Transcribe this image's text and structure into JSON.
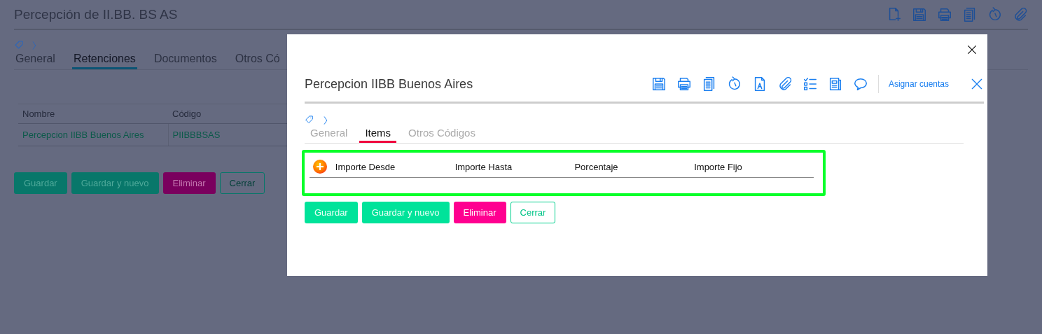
{
  "page": {
    "title": "Percepción de II.BB. BS AS",
    "tabs": [
      {
        "label": "General",
        "selected": false
      },
      {
        "label": "Retenciones",
        "selected": true
      },
      {
        "label": "Documentos",
        "selected": false
      },
      {
        "label": "Otros Có",
        "selected": false
      }
    ],
    "table": {
      "columns": [
        "Nombre",
        "Código"
      ],
      "rows": [
        [
          "Percepcion IIBB Buenos Aires",
          "PIIBBBSAS"
        ]
      ]
    },
    "buttons": [
      {
        "label": "Guardar",
        "kind": "primary"
      },
      {
        "label": "Guardar y nuevo",
        "kind": "primary"
      },
      {
        "label": "Eliminar",
        "kind": "danger"
      },
      {
        "label": "Cerrar",
        "kind": "outline"
      }
    ]
  },
  "dialog": {
    "title": "Percepcion IIBB Buenos Aires",
    "toolbar_link": "Asignar cuentas",
    "tabs": [
      {
        "label": "General",
        "selected": false
      },
      {
        "label": "Items",
        "selected": true
      },
      {
        "label": "Otros Códigos",
        "selected": false
      }
    ],
    "items_table": {
      "columns": [
        "Importe Desde",
        "Importe Hasta",
        "Porcentaje",
        "Importe Fijo"
      ]
    },
    "buttons": [
      {
        "label": "Guardar",
        "kind": "primary"
      },
      {
        "label": "Guardar y nuevo",
        "kind": "primary"
      },
      {
        "label": "Eliminar",
        "kind": "danger"
      },
      {
        "label": "Cerrar",
        "kind": "outline"
      }
    ]
  }
}
